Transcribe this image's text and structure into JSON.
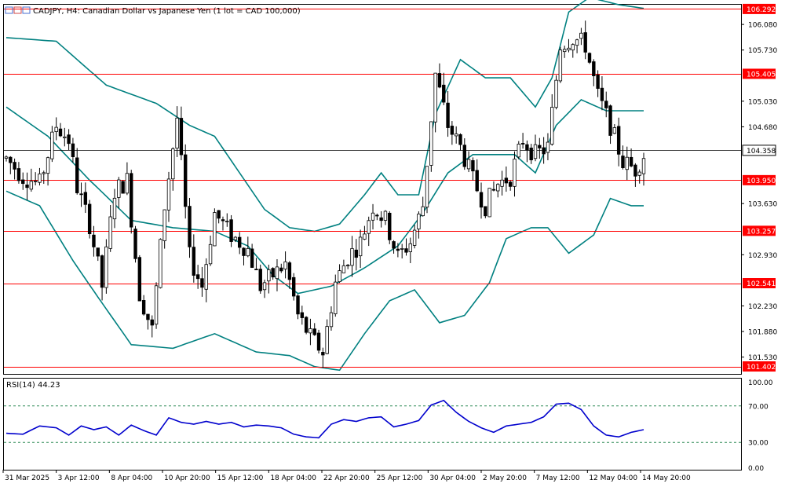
{
  "header": {
    "symbol": "CADJPY",
    "timeframe": "H4",
    "description": "Canadian Dollar vs Japanese Yen (1 lot = CAD 100,000)",
    "title": "CADJPY, H4:  Canadian Dollar vs Japanese Yen (1 lot = CAD 100,000)",
    "icon": "chart-window-icons"
  },
  "chart_data": [
    {
      "type": "candlestick",
      "symbol": "CADJPY",
      "timeframe": "H4",
      "ylim": [
        101.3,
        106.35
      ],
      "price_axis_ticks": [
        "106.080",
        "105.730",
        "105.030",
        "104.680",
        "103.630",
        "102.930",
        "102.230",
        "101.880",
        "101.530"
      ],
      "x_tick_labels": [
        "31 Mar 2025",
        "3 Apr 12:00",
        "8 Apr 04:00",
        "10 Apr 20:00",
        "15 Apr 12:00",
        "18 Apr 04:00",
        "22 Apr 20:00",
        "25 Apr 12:00",
        "30 Apr 04:00",
        "2 May 20:00",
        "7 May 12:00",
        "12 May 04:00",
        "14 May 20:00"
      ],
      "levels": [
        {
          "label": "106.292",
          "value": 106.292,
          "color": "#ff0000"
        },
        {
          "label": "105.405",
          "value": 105.405,
          "color": "#ff0000"
        },
        {
          "label": "103.950",
          "value": 103.95,
          "color": "#ff0000"
        },
        {
          "label": "103.257",
          "value": 103.257,
          "color": "#ff0000"
        },
        {
          "label": "102.541",
          "value": 102.541,
          "color": "#ff0000"
        },
        {
          "label": "101.402",
          "value": 101.402,
          "color": "#ff0000"
        }
      ],
      "current_price": {
        "label": "104.358",
        "value": 104.358
      },
      "indicator": {
        "name": "Bollinger Bands",
        "color": "#008080"
      },
      "close_path": [
        [
          0,
          104.25
        ],
        [
          4,
          104.0
        ],
        [
          8,
          103.9
        ],
        [
          12,
          104.7
        ],
        [
          15,
          104.5
        ],
        [
          17,
          103.85
        ],
        [
          20,
          103.35
        ],
        [
          23,
          102.5
        ],
        [
          26,
          103.8
        ],
        [
          29,
          103.95
        ],
        [
          32,
          102.4
        ],
        [
          35,
          101.9
        ],
        [
          38,
          103.6
        ],
        [
          41,
          104.8
        ],
        [
          44,
          102.9
        ],
        [
          47,
          102.5
        ],
        [
          50,
          103.5
        ],
        [
          54,
          103.2
        ],
        [
          58,
          103.0
        ],
        [
          61,
          102.5
        ],
        [
          64,
          102.65
        ],
        [
          67,
          102.8
        ],
        [
          70,
          102.1
        ],
        [
          73,
          101.8
        ],
        [
          76,
          101.6
        ],
        [
          79,
          102.55
        ],
        [
          82,
          102.9
        ],
        [
          85,
          103.1
        ],
        [
          88,
          103.6
        ],
        [
          91,
          103.4
        ],
        [
          94,
          102.9
        ],
        [
          97,
          103.1
        ],
        [
          100,
          103.6
        ],
        [
          103,
          105.4
        ],
        [
          106,
          104.7
        ],
        [
          109,
          104.4
        ],
        [
          112,
          103.95
        ],
        [
          115,
          103.6
        ],
        [
          118,
          103.9
        ],
        [
          121,
          104.0
        ],
        [
          124,
          104.5
        ],
        [
          127,
          104.3
        ],
        [
          130,
          104.4
        ],
        [
          133,
          105.8
        ],
        [
          136,
          105.9
        ],
        [
          139,
          105.8
        ],
        [
          142,
          105.1
        ],
        [
          145,
          104.7
        ],
        [
          148,
          104.2
        ],
        [
          151,
          104.1
        ],
        [
          153,
          104.3
        ]
      ],
      "bollinger_upper": [
        [
          0,
          105.9
        ],
        [
          12,
          105.85
        ],
        [
          24,
          105.25
        ],
        [
          36,
          105.0
        ],
        [
          44,
          104.7
        ],
        [
          50,
          104.55
        ],
        [
          56,
          104.05
        ],
        [
          62,
          103.55
        ],
        [
          68,
          103.3
        ],
        [
          74,
          103.25
        ],
        [
          80,
          103.35
        ],
        [
          86,
          103.75
        ],
        [
          90,
          104.05
        ],
        [
          94,
          103.75
        ],
        [
          99,
          103.75
        ],
        [
          103,
          104.85
        ],
        [
          109,
          105.6
        ],
        [
          115,
          105.35
        ],
        [
          121,
          105.35
        ],
        [
          127,
          104.95
        ],
        [
          131,
          105.35
        ],
        [
          135,
          106.25
        ],
        [
          140,
          106.45
        ],
        [
          147,
          106.35
        ],
        [
          153,
          106.3
        ]
      ],
      "bollinger_middle": [
        [
          0,
          104.95
        ],
        [
          10,
          104.55
        ],
        [
          20,
          103.95
        ],
        [
          30,
          103.4
        ],
        [
          40,
          103.3
        ],
        [
          50,
          103.25
        ],
        [
          58,
          103.05
        ],
        [
          64,
          102.65
        ],
        [
          70,
          102.4
        ],
        [
          78,
          102.5
        ],
        [
          86,
          102.75
        ],
        [
          94,
          103.05
        ],
        [
          100,
          103.5
        ],
        [
          106,
          104.05
        ],
        [
          112,
          104.3
        ],
        [
          118,
          104.3
        ],
        [
          122,
          104.3
        ],
        [
          127,
          104.05
        ],
        [
          132,
          104.7
        ],
        [
          138,
          105.05
        ],
        [
          144,
          104.9
        ],
        [
          153,
          104.9
        ]
      ],
      "bollinger_lower": [
        [
          0,
          103.8
        ],
        [
          8,
          103.6
        ],
        [
          16,
          102.85
        ],
        [
          22,
          102.35
        ],
        [
          30,
          101.7
        ],
        [
          40,
          101.65
        ],
        [
          50,
          101.85
        ],
        [
          60,
          101.6
        ],
        [
          68,
          101.55
        ],
        [
          74,
          101.4
        ],
        [
          80,
          101.35
        ],
        [
          86,
          101.85
        ],
        [
          92,
          102.3
        ],
        [
          98,
          102.45
        ],
        [
          104,
          102.0
        ],
        [
          110,
          102.1
        ],
        [
          116,
          102.55
        ],
        [
          120,
          103.15
        ],
        [
          126,
          103.3
        ],
        [
          130,
          103.3
        ],
        [
          135,
          102.95
        ],
        [
          141,
          103.2
        ],
        [
          145,
          103.7
        ],
        [
          150,
          103.6
        ],
        [
          153,
          103.6
        ]
      ]
    },
    {
      "type": "line",
      "indicator": "RSI(14)",
      "label": "RSI(14) 44.23",
      "name": "RSI(14)",
      "value": "44.23",
      "ylim": [
        0,
        100
      ],
      "ticks": [
        "100.00",
        "70.00",
        "30.00",
        "0.00"
      ],
      "levels": [
        70,
        30
      ],
      "color": "#0000cd",
      "values": [
        [
          0,
          40
        ],
        [
          4,
          39
        ],
        [
          8,
          48
        ],
        [
          12,
          46
        ],
        [
          15,
          38
        ],
        [
          18,
          48
        ],
        [
          21,
          44
        ],
        [
          24,
          47
        ],
        [
          27,
          38
        ],
        [
          30,
          49
        ],
        [
          33,
          43
        ],
        [
          36,
          38
        ],
        [
          39,
          57
        ],
        [
          42,
          52
        ],
        [
          45,
          50
        ],
        [
          48,
          53
        ],
        [
          51,
          50
        ],
        [
          54,
          52
        ],
        [
          57,
          47
        ],
        [
          60,
          49
        ],
        [
          63,
          48
        ],
        [
          66,
          46
        ],
        [
          69,
          39
        ],
        [
          72,
          36
        ],
        [
          75,
          35
        ],
        [
          78,
          50
        ],
        [
          81,
          55
        ],
        [
          84,
          53
        ],
        [
          87,
          57
        ],
        [
          90,
          58
        ],
        [
          93,
          47
        ],
        [
          96,
          50
        ],
        [
          99,
          54
        ],
        [
          102,
          71
        ],
        [
          105,
          76
        ],
        [
          108,
          63
        ],
        [
          111,
          53
        ],
        [
          114,
          46
        ],
        [
          117,
          41
        ],
        [
          120,
          48
        ],
        [
          123,
          50
        ],
        [
          126,
          52
        ],
        [
          129,
          58
        ],
        [
          132,
          72
        ],
        [
          135,
          73
        ],
        [
          138,
          66
        ],
        [
          141,
          48
        ],
        [
          144,
          38
        ],
        [
          147,
          36
        ],
        [
          150,
          41
        ],
        [
          153,
          44
        ]
      ]
    }
  ]
}
